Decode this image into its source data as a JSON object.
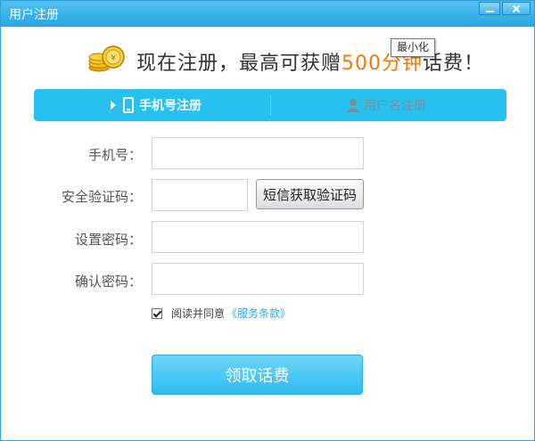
{
  "window": {
    "title": "用户注册",
    "tooltip": "最小化"
  },
  "promo": {
    "prefix": "现在注册，最高可获赠",
    "highlight": "500分钟",
    "suffix": "话费！"
  },
  "tabs": [
    {
      "label": "手机号注册",
      "active": true
    },
    {
      "label": "用户名注册",
      "active": false
    }
  ],
  "form": {
    "phone_label": "手机号：",
    "phone_value": "",
    "code_label": "安全验证码：",
    "code_value": "",
    "sms_button": "短信获取验证码",
    "password_label": "设置密码：",
    "password_value": "",
    "confirm_label": "确认密码：",
    "confirm_value": ""
  },
  "agreement": {
    "checked": true,
    "text": "阅读并同意",
    "link": "《服务条款》"
  },
  "submit_label": "领取话费",
  "colors": {
    "accent": "#27c1f0",
    "highlight": "#f27a08",
    "link": "#2fa8e0"
  }
}
